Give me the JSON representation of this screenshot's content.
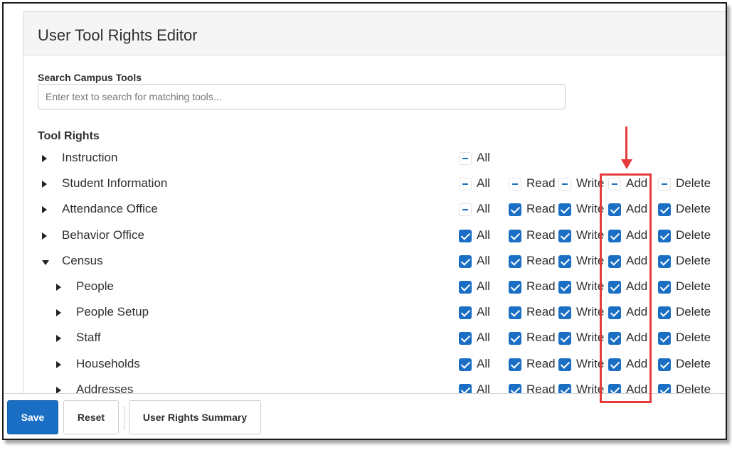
{
  "panel": {
    "title": "User Tool Rights Editor"
  },
  "search": {
    "label": "Search Campus Tools",
    "placeholder": "Enter text to search for matching tools...",
    "value": ""
  },
  "tool_rights": {
    "label": "Tool Rights",
    "rows": [
      {
        "label": "Instruction",
        "expanded": false,
        "level": 0,
        "rights": {
          "all": "partial"
        }
      },
      {
        "label": "Student Information",
        "expanded": false,
        "level": 0,
        "rights": {
          "all": "partial",
          "read": "partial",
          "write": "partial",
          "add": "partial",
          "delete": "partial"
        }
      },
      {
        "label": "Attendance Office",
        "expanded": false,
        "level": 0,
        "rights": {
          "all": "partial",
          "read": "checked",
          "write": "checked",
          "add": "checked",
          "delete": "checked"
        }
      },
      {
        "label": "Behavior Office",
        "expanded": false,
        "level": 0,
        "rights": {
          "all": "checked",
          "read": "checked",
          "write": "checked",
          "add": "checked",
          "delete": "checked"
        }
      },
      {
        "label": "Census",
        "expanded": true,
        "level": 0,
        "rights": {
          "all": "checked",
          "read": "checked",
          "write": "checked",
          "add": "checked",
          "delete": "checked"
        }
      },
      {
        "label": "People",
        "expanded": false,
        "level": 1,
        "rights": {
          "all": "checked",
          "read": "checked",
          "write": "checked",
          "add": "checked",
          "delete": "checked"
        }
      },
      {
        "label": "People Setup",
        "expanded": false,
        "level": 1,
        "rights": {
          "all": "checked",
          "read": "checked",
          "write": "checked",
          "add": "checked",
          "delete": "checked"
        }
      },
      {
        "label": "Staff",
        "expanded": false,
        "level": 1,
        "rights": {
          "all": "checked",
          "read": "checked",
          "write": "checked",
          "add": "checked",
          "delete": "checked"
        }
      },
      {
        "label": "Households",
        "expanded": false,
        "level": 1,
        "rights": {
          "all": "checked",
          "read": "checked",
          "write": "checked",
          "add": "checked",
          "delete": "checked"
        }
      },
      {
        "label": "Addresses",
        "expanded": false,
        "level": 1,
        "rights": {
          "all": "checked",
          "read": "checked",
          "write": "checked",
          "add": "checked",
          "delete": "checked"
        }
      }
    ]
  },
  "rights_labels": {
    "all": "All",
    "read": "Read",
    "write": "Write",
    "add": "Add",
    "delete": "Delete"
  },
  "footer": {
    "save": "Save",
    "reset": "Reset",
    "summary": "User Rights Summary"
  },
  "colors": {
    "accent": "#1a6fc4",
    "annotation": "#e53b3b"
  },
  "icons": {
    "expand": "caret-right-icon",
    "collapse": "caret-down-icon"
  }
}
